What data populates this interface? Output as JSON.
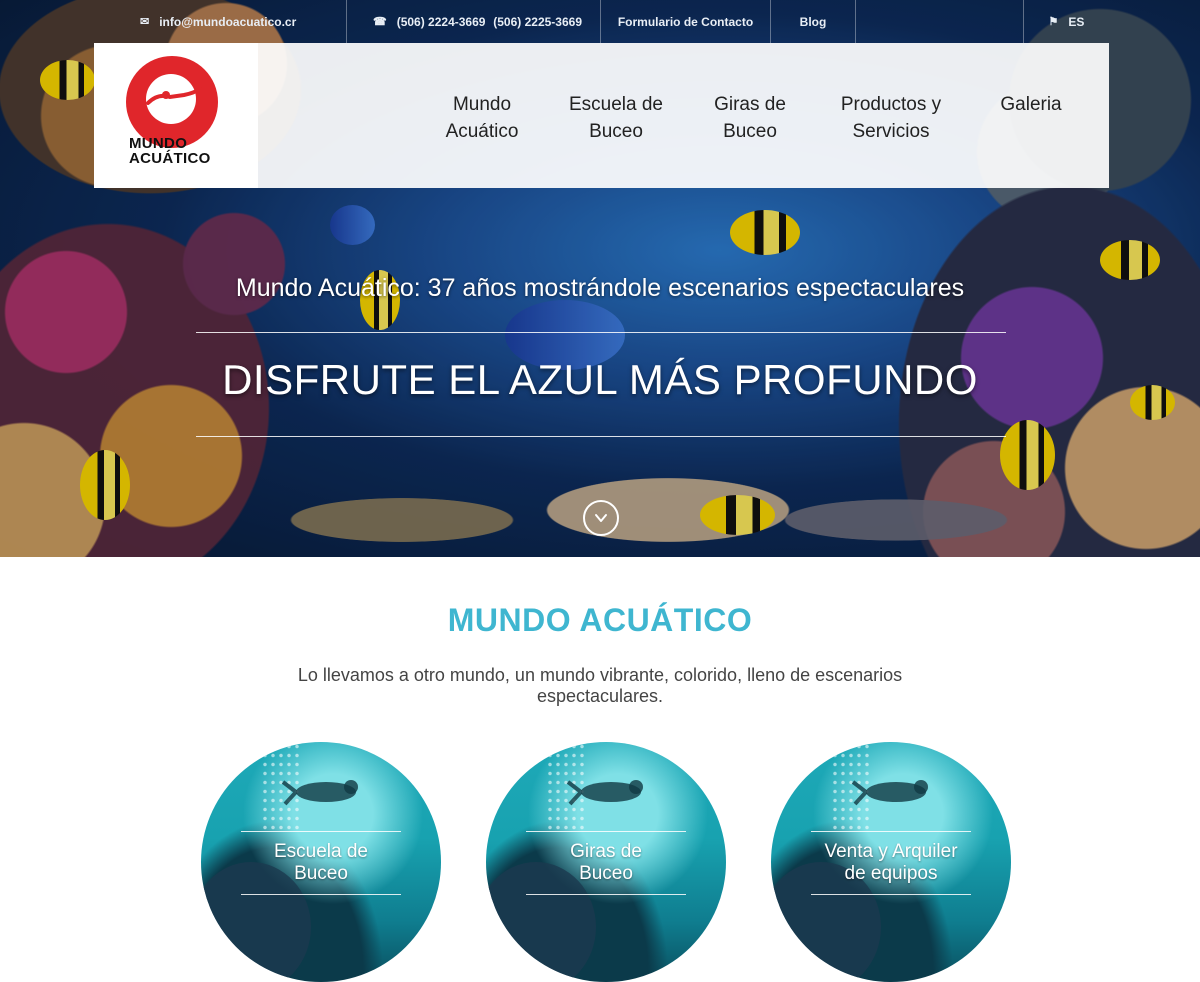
{
  "topbar": {
    "email": "info@mundoacuatico.cr",
    "phone1": "(506) 2224-3669",
    "phone2": "(506) 2225-3669",
    "contact_form": "Formulario de Contacto",
    "blog": "Blog",
    "language": "ES"
  },
  "logo": {
    "line1": "MUNDO",
    "line2": "ACUÁTICO"
  },
  "nav": [
    {
      "line1": "Mundo",
      "line2": "Acuático"
    },
    {
      "line1": "Escuela de",
      "line2": "Buceo"
    },
    {
      "line1": "Giras de",
      "line2": "Buceo"
    },
    {
      "line1": "Productos y",
      "line2": "Servicios"
    },
    {
      "line1": "Galeria",
      "line2": ""
    }
  ],
  "hero": {
    "subtitle": "Mundo Acuático: 37 años mostrándole escenarios espectaculares",
    "title": "DISFRUTE EL AZUL MÁS PROFUNDO"
  },
  "intro": {
    "title": "MUNDO ACUÁTICO",
    "text": "Lo llevamos a otro mundo, un mundo vibrante, colorido, lleno de escenarios espectaculares."
  },
  "cards": [
    {
      "line1": "Escuela de",
      "line2": "Buceo"
    },
    {
      "line1": "Giras de",
      "line2": "Buceo"
    },
    {
      "line1": "Venta y Arquiler",
      "line2": "de equipos"
    }
  ],
  "colors": {
    "accent": "#3fb6d0",
    "logo_red": "#e0262b"
  }
}
